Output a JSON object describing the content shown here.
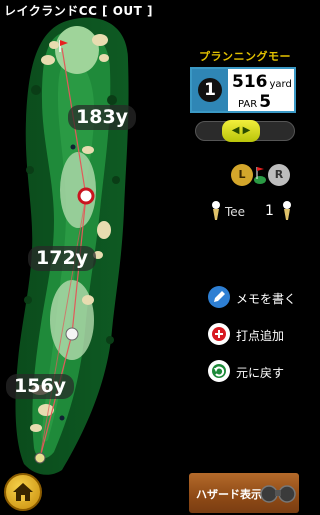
{
  "header": {
    "course_title": "レイクランドCC [ OUT ]"
  },
  "map": {
    "distance_markers": [
      "183y",
      "172y",
      "156y"
    ]
  },
  "panel": {
    "mode_label": "プランニングモード",
    "hole_number": "1",
    "yardage": "516",
    "yardage_unit": "yard",
    "par_label": "PAR",
    "par_value": "5",
    "green_left": "L",
    "green_right": "R",
    "tee_label": "Tee",
    "tee_value": "1"
  },
  "actions": {
    "memo_label": "メモを書く",
    "add_point_label": "打点追加",
    "undo_label": "元に戻す"
  },
  "footer": {
    "hazard_label": "ハザード表示"
  },
  "colors": {
    "mode_label": "#e2c100",
    "hole_box_border": "#3a98c4",
    "fairway": "#1f8a3a",
    "rough_dark": "#0f5b22"
  }
}
